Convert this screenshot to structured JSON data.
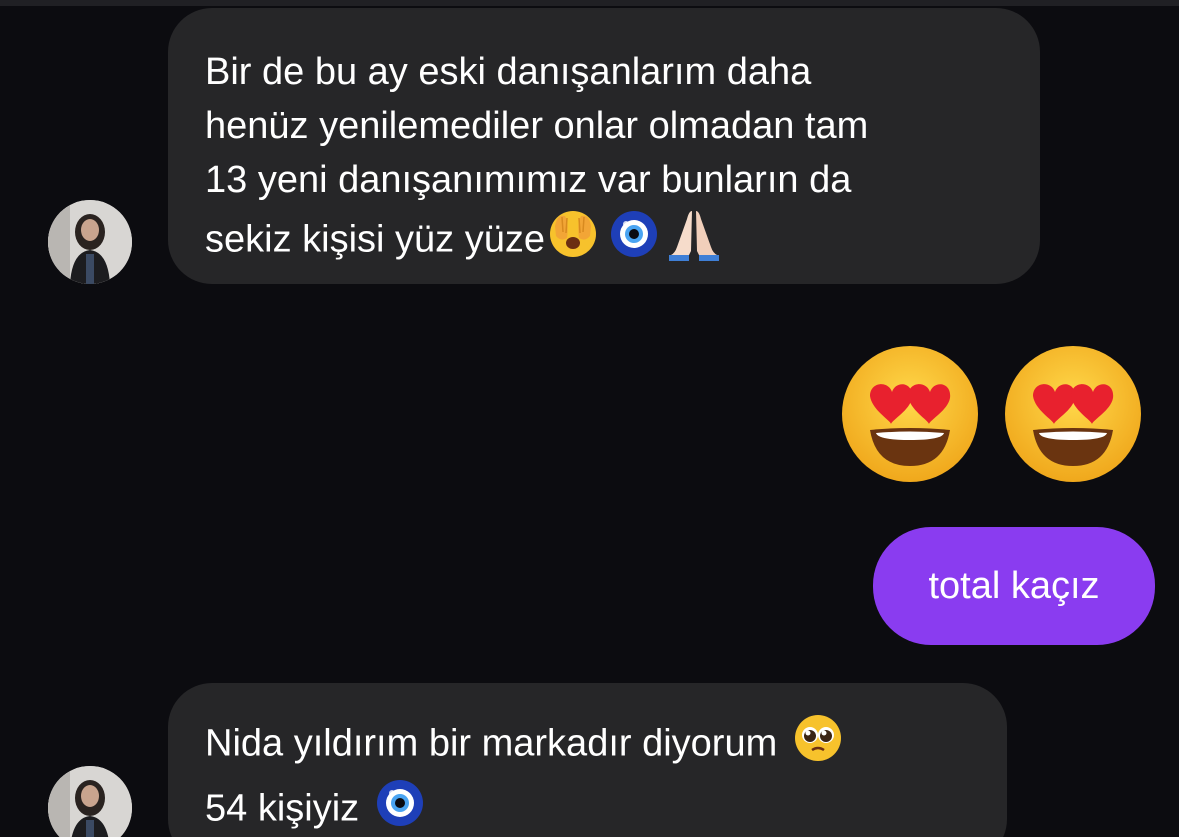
{
  "messages": [
    {
      "from": "contact",
      "lines": [
        "Bir de bu ay eski danışanlarım daha",
        "henüz yenilemediler onlar olmadan tam",
        "13 yeni danışanımımız var bunların da",
        "sekiz kişisi yüz  yüze"
      ],
      "trailing_emojis": [
        "face-with-open-eyes-and-hand-over-mouth",
        "nazar-amulet",
        "folded-hands"
      ]
    },
    {
      "from": "me",
      "emojis": [
        "smiling-face-with-heart-eyes",
        "smiling-face-with-heart-eyes"
      ]
    },
    {
      "from": "me",
      "text": "total kaçız"
    },
    {
      "from": "contact",
      "lines": [
        "Nida yıldırım bir markadır diyorum",
        "54 kişiyiz"
      ],
      "line_emojis": [
        "pleading-face",
        "nazar-amulet"
      ]
    }
  ],
  "colors": {
    "background": "#0c0c10",
    "incoming_bubble": "#262628",
    "outgoing_bubble": "#8a3cf0",
    "text": "#ffffff"
  }
}
